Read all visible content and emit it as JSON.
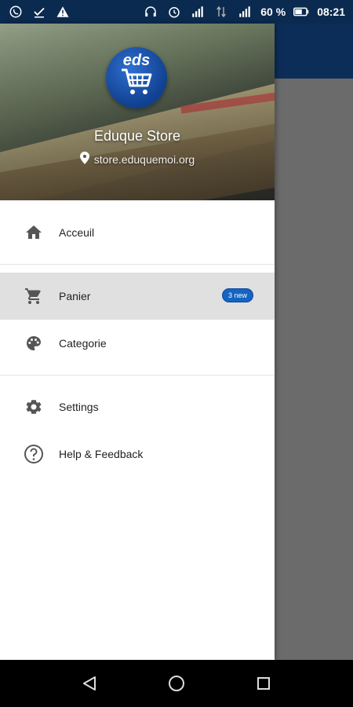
{
  "status_bar": {
    "battery_percent": "60 %",
    "time": "08:21",
    "left_icons": [
      "whatsapp-icon",
      "check-download-icon",
      "warning-icon"
    ],
    "right_icons": [
      "headphones-icon",
      "alarm-icon",
      "signal-icon",
      "data-transfer-icon",
      "signal-icon",
      "battery-icon"
    ]
  },
  "drawer": {
    "header": {
      "logo_text": "eds",
      "store_name": "Eduque Store",
      "store_url": "store.eduquemoi.org"
    },
    "menu": {
      "home": {
        "label": "Acceuil",
        "icon": "home-icon"
      },
      "cart": {
        "label": "Panier",
        "icon": "cart-icon",
        "badge": "3 new"
      },
      "category": {
        "label": "Categorie",
        "icon": "palette-icon"
      },
      "settings": {
        "label": "Settings",
        "icon": "gear-icon"
      },
      "help": {
        "label": "Help & Feedback",
        "icon": "help-icon"
      }
    }
  },
  "colors": {
    "status_bar_bg": "#0b2a4f",
    "app_bar": "#0c2d57",
    "accent_badge": "#1565c0",
    "active_row": "#e0e0e0",
    "scrim": "#6b6b6b"
  },
  "nav_bar": {
    "buttons": [
      "back-icon",
      "home-circle-icon",
      "recents-icon"
    ]
  }
}
